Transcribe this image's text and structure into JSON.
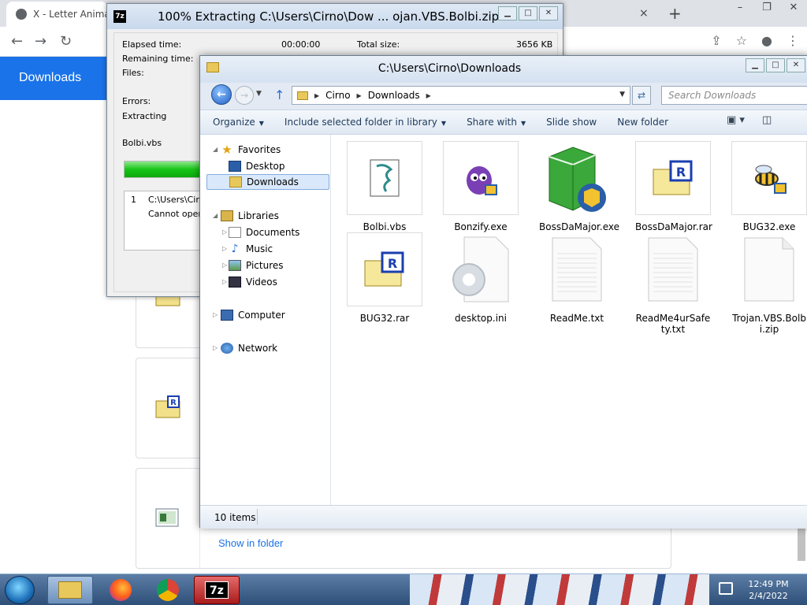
{
  "chrome": {
    "tab_title": "X - Letter Animat",
    "tab_close": "×",
    "new_tab": "+",
    "win_min": "–",
    "win_max": "❐",
    "win_close": "✕",
    "downloads_title": "Downloads",
    "show_in_folder": "Show in folder",
    "accent": "#1a73e8"
  },
  "zip": {
    "logo": "7z",
    "title": "100% Extracting C:\\Users\\Cirno\\Dow ... ojan.VBS.Bolbi.zip",
    "elapsed_label": "Elapsed time:",
    "elapsed_value": "00:00:00",
    "remaining_label": "Remaining time:",
    "files_label": "Files:",
    "total_size_label": "Total size:",
    "total_size_value": "3656 KB",
    "errors_label": "Errors:",
    "extracting_label": "Extracting",
    "current_file": "Bolbi.vbs",
    "progress": 1.0,
    "message_index": "1",
    "message_path": "C:\\Users\\Cirn",
    "message_text": "Cannot open f",
    "progress_color": "#17c417"
  },
  "explorer": {
    "title": "C:\\Users\\Cirno\\Downloads",
    "breadcrumb": [
      "Cirno",
      "Downloads"
    ],
    "search_placeholder": "Search Downloads",
    "commands": [
      {
        "label": "Organize",
        "has_dropdown": true
      },
      {
        "label": "Include selected folder in library",
        "has_dropdown": true
      },
      {
        "label": "Share with",
        "has_dropdown": true
      },
      {
        "label": "Slide show",
        "has_dropdown": false
      },
      {
        "label": "New folder",
        "has_dropdown": false
      }
    ],
    "nav": {
      "favorites": "Favorites",
      "desktop": "Desktop",
      "downloads": "Downloads",
      "libraries": "Libraries",
      "documents": "Documents",
      "music": "Music",
      "pictures": "Pictures",
      "videos": "Videos",
      "computer": "Computer",
      "network": "Network"
    },
    "files": [
      {
        "name": "Bolbi.vbs",
        "icon": "vbs-script-icon"
      },
      {
        "name": "Bonzify.exe",
        "icon": "bonzi-purple-icon"
      },
      {
        "name": "BossDaMajor.exe",
        "icon": "installer-box-icon"
      },
      {
        "name": "BossDaMajor.rar",
        "icon": "rar-archive-icon"
      },
      {
        "name": "BUG32.exe",
        "icon": "wasp-icon"
      },
      {
        "name": "BUG32.rar",
        "icon": "rar-archive-icon"
      },
      {
        "name": "desktop.ini",
        "icon": "ini-gear-icon"
      },
      {
        "name": "ReadMe.txt",
        "icon": "text-file-icon"
      },
      {
        "name": "ReadMe4urSafety.txt",
        "icon": "text-file-icon"
      },
      {
        "name": "Trojan.VBS.Bolbi.zip",
        "icon": "blank-file-icon"
      }
    ],
    "status": "10 items"
  },
  "taskbar": {
    "time": "12:49 PM",
    "date": "2/4/2022",
    "zip_label": "7z"
  }
}
